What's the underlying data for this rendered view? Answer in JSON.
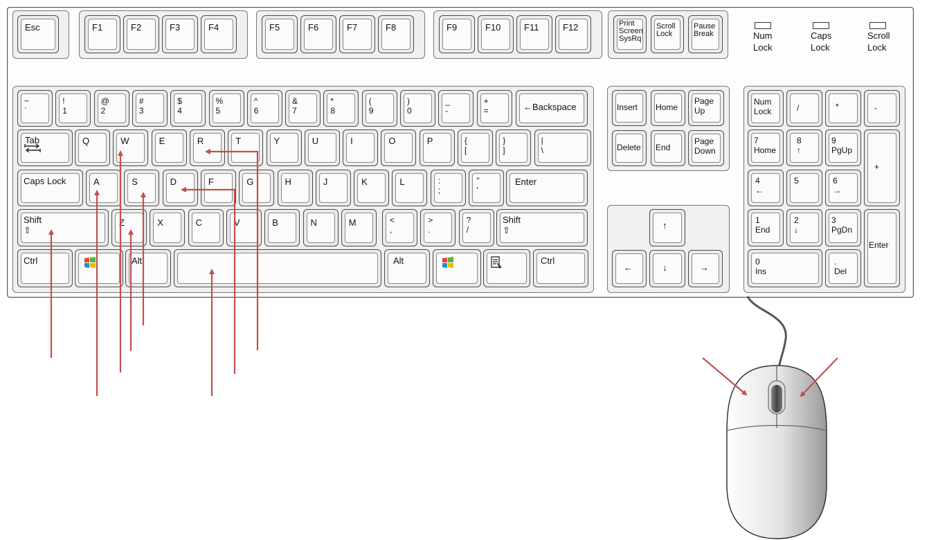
{
  "keyboard": {
    "function_row": [
      "Esc",
      "F1",
      "F2",
      "F3",
      "F4",
      "F5",
      "F6",
      "F7",
      "F8",
      "F9",
      "F10",
      "F11",
      "F12"
    ],
    "system_keys": [
      {
        "label": "Print\nScreen\nSysRq"
      },
      {
        "label": "Scroll\nLock"
      },
      {
        "label": "Pause\nBreak"
      }
    ],
    "indicators": [
      {
        "label": "Num\nLock"
      },
      {
        "label": "Caps\nLock"
      },
      {
        "label": "Scroll\nLock"
      }
    ],
    "number_row": [
      {
        "top": "~",
        "bottom": "`"
      },
      {
        "top": "!",
        "bottom": "1"
      },
      {
        "top": "@",
        "bottom": "2"
      },
      {
        "top": "#",
        "bottom": "3"
      },
      {
        "top": "$",
        "bottom": "4"
      },
      {
        "top": "%",
        "bottom": "5"
      },
      {
        "top": "^",
        "bottom": "6"
      },
      {
        "top": "&",
        "bottom": "7"
      },
      {
        "top": "*",
        "bottom": "8"
      },
      {
        "top": "(",
        "bottom": "9"
      },
      {
        "top": ")",
        "bottom": "0"
      },
      {
        "top": "_",
        "bottom": "-"
      },
      {
        "top": "+",
        "bottom": "="
      }
    ],
    "backspace": "←Backspace",
    "tab": "Tab",
    "qwerty_row": [
      "Q",
      "W",
      "E",
      "R",
      "T",
      "Y",
      "U",
      "I",
      "O",
      "P"
    ],
    "bracket_keys": [
      {
        "top": "{",
        "bottom": "["
      },
      {
        "top": "}",
        "bottom": "]"
      },
      {
        "top": "|",
        "bottom": "\\"
      }
    ],
    "caps_lock": "Caps Lock",
    "home_row": [
      "A",
      "S",
      "D",
      "F",
      "G",
      "H",
      "J",
      "K",
      "L"
    ],
    "home_punct": [
      {
        "top": ":",
        "bottom": ";"
      },
      {
        "top": "\"",
        "bottom": "'"
      }
    ],
    "enter": "Enter",
    "shift": "Shift",
    "shift_symbol": "⇧",
    "bottom_row_letters": [
      "Z",
      "X",
      "C",
      "V",
      "B",
      "N",
      "M"
    ],
    "bottom_punct": [
      {
        "top": "<",
        "bottom": ","
      },
      {
        "top": ">",
        "bottom": "."
      },
      {
        "top": "?",
        "bottom": "/"
      }
    ],
    "ctrl": "Ctrl",
    "alt": "Alt",
    "nav_keys": [
      {
        "label": "Insert"
      },
      {
        "label": "Home"
      },
      {
        "label": "Page\nUp"
      },
      {
        "label": "Delete"
      },
      {
        "label": "End"
      },
      {
        "label": "Page\nDown"
      }
    ],
    "arrows": {
      "up": "↑",
      "left": "←",
      "down": "↓",
      "right": "→"
    },
    "numpad": [
      {
        "label": "Num\nLock"
      },
      {
        "label": "/"
      },
      {
        "label": "*"
      },
      {
        "label": "-"
      },
      {
        "label": "7\nHome"
      },
      {
        "label": "8\n↑"
      },
      {
        "label": "9\nPgUp"
      },
      {
        "label": "+"
      },
      {
        "label": "4\n←"
      },
      {
        "label": "5"
      },
      {
        "label": "6\n→"
      },
      {
        "label": "1\nEnd"
      },
      {
        "label": "2\n↓"
      },
      {
        "label": "3\nPgDn"
      },
      {
        "label": "Enter"
      },
      {
        "label": "0\nIns"
      },
      {
        "label": ".\nDel"
      }
    ],
    "accent_color": "#c0504d"
  }
}
